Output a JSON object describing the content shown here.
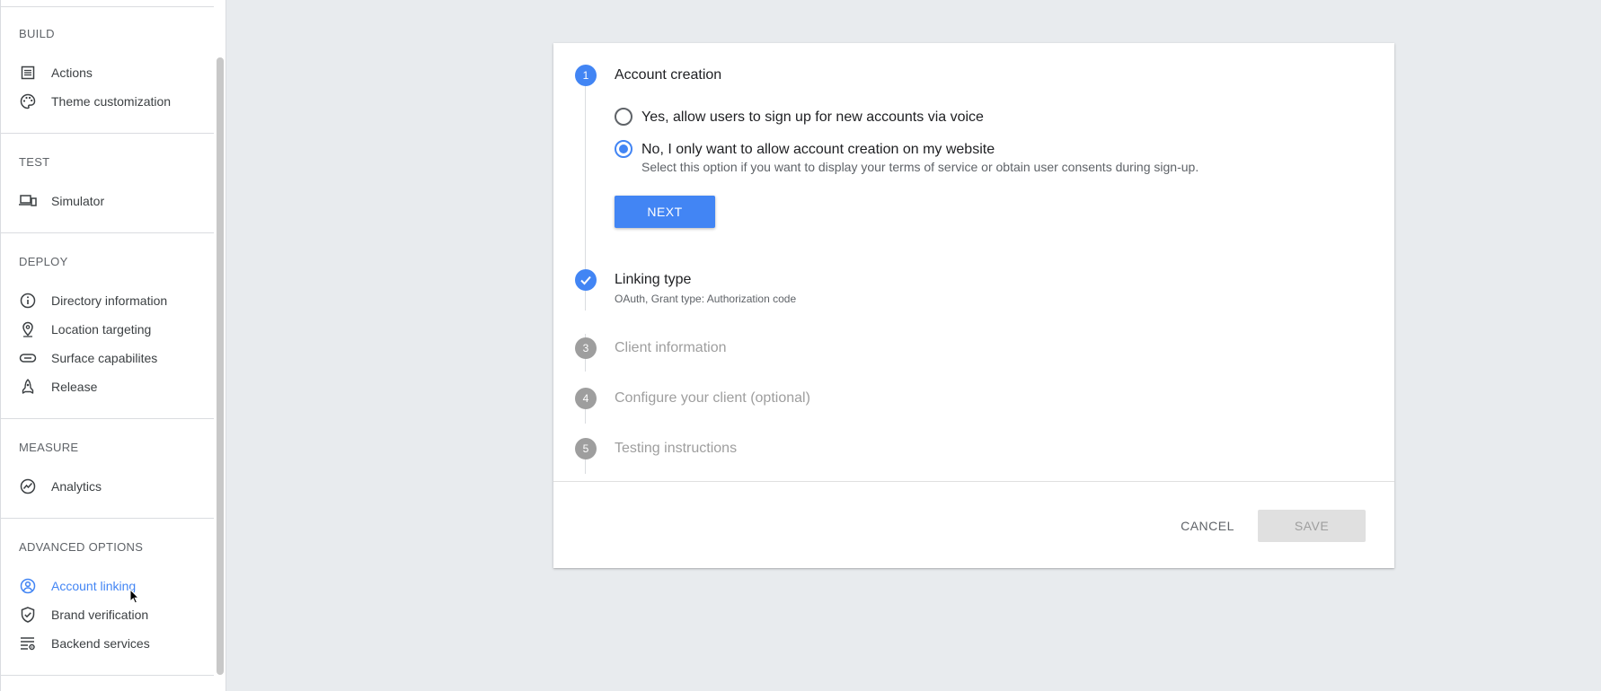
{
  "sidebar": {
    "sections": [
      {
        "title": "BUILD",
        "items": [
          {
            "label": "Actions",
            "icon": "list-icon"
          },
          {
            "label": "Theme customization",
            "icon": "palette-icon"
          }
        ]
      },
      {
        "title": "TEST",
        "items": [
          {
            "label": "Simulator",
            "icon": "devices-icon"
          }
        ]
      },
      {
        "title": "DEPLOY",
        "items": [
          {
            "label": "Directory information",
            "icon": "info-icon"
          },
          {
            "label": "Location targeting",
            "icon": "location-pin-icon"
          },
          {
            "label": "Surface capabilites",
            "icon": "link-icon"
          },
          {
            "label": "Release",
            "icon": "rocket-icon"
          }
        ]
      },
      {
        "title": "MEASURE",
        "items": [
          {
            "label": "Analytics",
            "icon": "analytics-icon"
          }
        ]
      },
      {
        "title": "ADVANCED OPTIONS",
        "items": [
          {
            "label": "Account linking",
            "icon": "account-circle-icon",
            "active": true
          },
          {
            "label": "Brand verification",
            "icon": "verified-shield-icon"
          },
          {
            "label": "Backend services",
            "icon": "settings-list-icon"
          }
        ]
      }
    ]
  },
  "stepper": {
    "steps": [
      {
        "number": "1",
        "title": "Account creation",
        "state": "active"
      },
      {
        "number": "",
        "title": "Linking type",
        "subtitle": "OAuth, Grant type: Authorization code",
        "state": "done"
      },
      {
        "number": "3",
        "title": "Client information",
        "state": "inactive"
      },
      {
        "number": "4",
        "title": "Configure your client (optional)",
        "state": "inactive"
      },
      {
        "number": "5",
        "title": "Testing instructions",
        "state": "inactive"
      }
    ],
    "options": [
      {
        "label": "Yes, allow users to sign up for new accounts via voice",
        "checked": false
      },
      {
        "label": "No, I only want to allow account creation on my website",
        "hint": "Select this option if you want to display your terms of service or obtain user consents during sign-up.",
        "checked": true
      }
    ],
    "next_label": "NEXT"
  },
  "footer": {
    "cancel_label": "CANCEL",
    "save_label": "SAVE"
  },
  "colors": {
    "accent": "#4285f4",
    "inactive": "#9e9e9e",
    "background": "#e8ebee"
  }
}
